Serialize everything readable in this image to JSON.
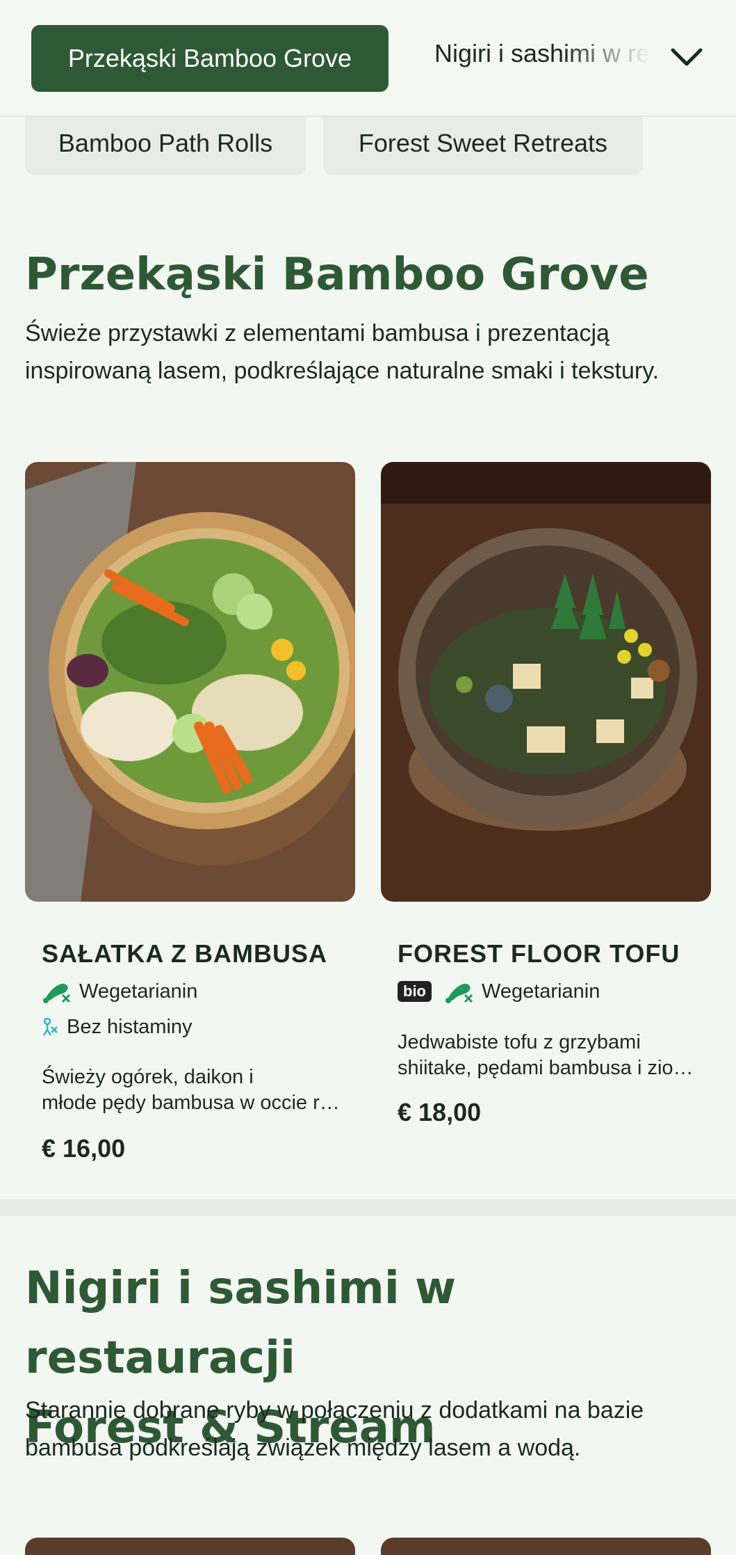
{
  "nav": {
    "active_category": "Przekąski Bamboo Grove",
    "next_category": "Nigiri i sashimi w restauracji Forest & Stream",
    "subcategories": [
      "Bamboo Path Rolls",
      "Forest Sweet Retreats"
    ],
    "expand_icon": "chevron-down-icon"
  },
  "section1": {
    "title": "Przekąski Bamboo Grove",
    "description": "Świeże przystawki z elementami bambusa i prezentacją inspirowaną lasem, podkreślające naturalne smaki i tekstury.",
    "dishes": [
      {
        "name": "SAŁATKA Z BAMBUSA",
        "tags": [
          {
            "icon": "leg-no-meat-icon",
            "label": "Wegetarianin"
          },
          {
            "icon": "histamine-free-icon",
            "label": "Bez histaminy"
          }
        ],
        "description_line1": "Świeży ogórek, daikon i",
        "description_line2": "młode pędy bambusa w occie ryżowym",
        "price": "€ 16,00"
      },
      {
        "name": "FOREST FLOOR TOFU",
        "badge": "bio",
        "tags": [
          {
            "icon": "leg-no-meat-icon",
            "label": "Wegetarianin"
          }
        ],
        "description_line1": "Jedwabiste tofu z grzybami",
        "description_line2": "shiitake, pędami bambusa i ziołami",
        "price": "€ 18,00"
      }
    ]
  },
  "section2": {
    "title_line1": "Nigiri i sashimi w restauracji",
    "title_line2": "Forest & Stream",
    "description": "Starannie dobrane ryby w połączeniu z dodatkami na bazie bambusa podkreślają związek między lasem a wodą."
  },
  "colors": {
    "brand_green": "#2e5935",
    "background": "#f3f7f2",
    "tag_green": "#1e9a5a",
    "tag_cyan": "#2bb7c9"
  }
}
